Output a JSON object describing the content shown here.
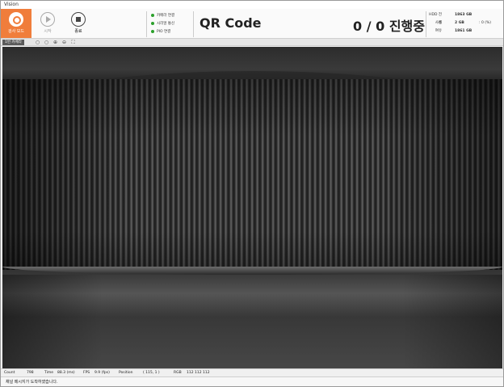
{
  "window": {
    "title": "Vision"
  },
  "toolbar": {
    "mode_label": "검사 모드",
    "start_label": "시작",
    "stop_label": "종료"
  },
  "status": [
    {
      "label": "카메라 연결",
      "color": "#2ca02c"
    },
    {
      "label": "시리얼 통신",
      "color": "#2ca02c"
    },
    {
      "label": "PIO 연결",
      "color": "#2ca02c"
    }
  ],
  "header": {
    "title": "QR Code",
    "progress": "0 / 0 진행중"
  },
  "hdd": {
    "total_label": "HDD 전체",
    "total_value": "1863 GB",
    "used_label": "사용",
    "used_value": "2 GB",
    "used_percent": ": 0 (%)",
    "free_label": "여유",
    "free_value": "1861 GB"
  },
  "viewbar": {
    "camera_tab": "1번 카메라"
  },
  "info": {
    "count_label": "Count",
    "count_value": "798",
    "time_label": "Time",
    "time_value": "88.3 (ms)",
    "fps_label": "FPS",
    "fps_value": "9.9 (fps)",
    "position_label": "Position",
    "position_value": "( 115,  1 )",
    "rgb_label": "RGB",
    "rgb_value": "112  112  112"
  },
  "message": "채널 메시지가 도착하였습니다.",
  "colors": {
    "accent": "#f07d3b",
    "ok": "#2ca02c"
  }
}
